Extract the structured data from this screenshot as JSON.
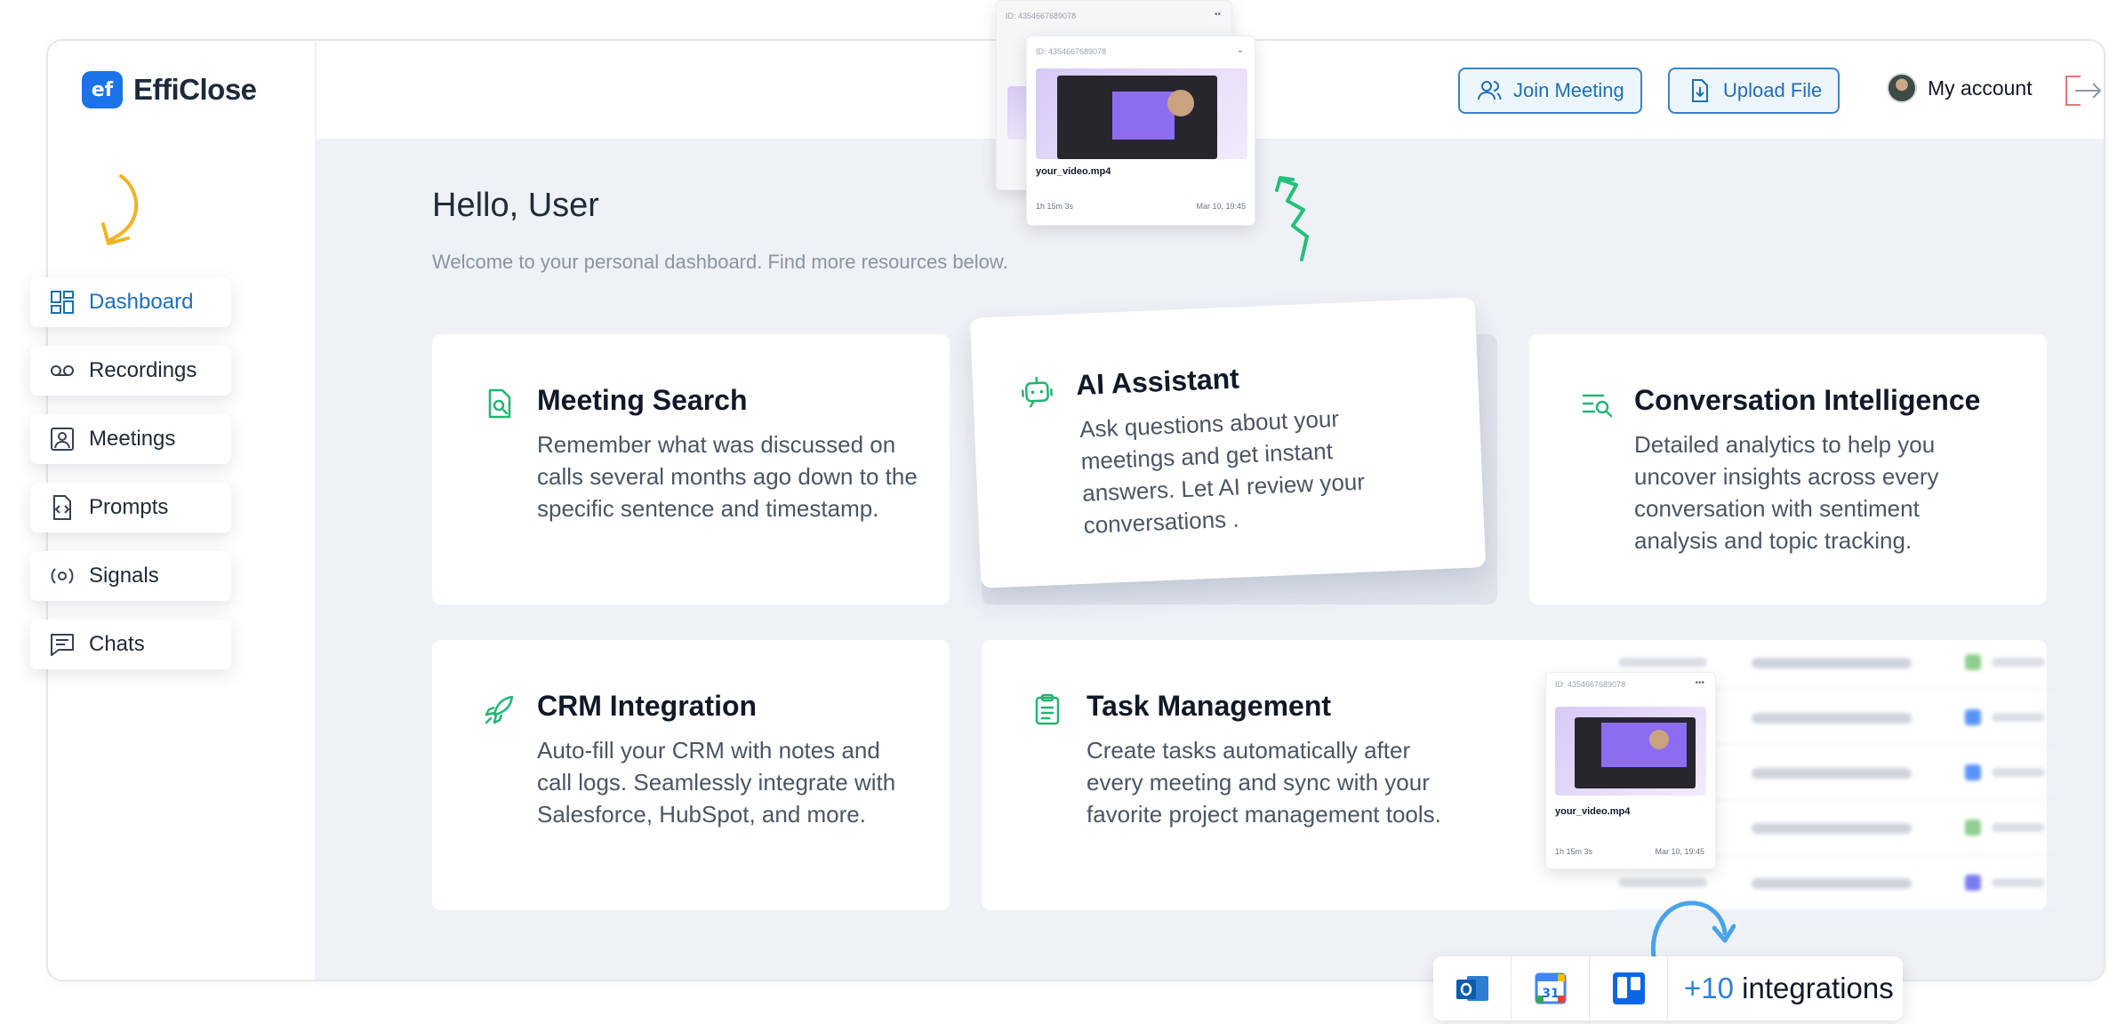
{
  "app": {
    "brand_badge": "ef",
    "brand_name": "EffiClose"
  },
  "topbar": {
    "join_meeting": "Join Meeting",
    "upload_file": "Upload File",
    "account": "My account"
  },
  "sidebar": {
    "items": [
      {
        "label": "Dashboard",
        "icon": "dashboard-icon",
        "active": true
      },
      {
        "label": "Recordings",
        "icon": "voicemail-icon",
        "active": false
      },
      {
        "label": "Meetings",
        "icon": "person-frame-icon",
        "active": false
      },
      {
        "label": "Prompts",
        "icon": "code-file-icon",
        "active": false
      },
      {
        "label": "Signals",
        "icon": "signal-icon",
        "active": false
      },
      {
        "label": "Chats",
        "icon": "chat-icon",
        "active": false
      }
    ]
  },
  "main": {
    "greeting": "Hello, User",
    "subtitle": "Welcome to your personal dashboard. Find more resources below.",
    "cards": [
      {
        "title": "Meeting Search",
        "body": "Remember what was discussed on calls several months ago down to the specific sentence and timestamp.",
        "icon": "file-search-icon"
      },
      {
        "title": "AI Assistant",
        "body": "Ask questions about your meetings and get instant answers. Let AI review your conversations .",
        "icon": "robot-icon"
      },
      {
        "title": "Conversation Intelligence",
        "body": "Detailed analytics to help you uncover insights across every conversation with sentiment analysis and topic tracking.",
        "icon": "list-search-icon"
      },
      {
        "title": "CRM Integration",
        "body": "Auto-fill your CRM with notes and call logs. Seamlessly integrate with Salesforce, HubSpot, and more.",
        "icon": "rocket-icon"
      },
      {
        "title": "Task Management",
        "body": "Create tasks automatically after every meeting and sync with your favorite project management tools.",
        "icon": "clipboard-icon"
      }
    ]
  },
  "previews": {
    "top_back": {
      "id": "ID: 4354667689078"
    },
    "top_front": {
      "id": "ID: 4354667689078",
      "file": "your_video.mp4",
      "duration": "1h 15m 3s",
      "date": "Mar 10, 19:45"
    },
    "bottom": {
      "id": "ID: 4354667689078",
      "file": "your_video.mp4",
      "duration": "1h 15m 3s",
      "date": "Mar 10, 19:45"
    }
  },
  "integrations": {
    "count": "+10",
    "label": "integrations",
    "icons": [
      "outlook-icon",
      "google-calendar-icon",
      "trello-icon"
    ]
  },
  "colors": {
    "accent": "#1d6fb8",
    "green": "#22b573",
    "brand": "#1a73e8",
    "arrow_yellow": "#f0b323",
    "arrow_blue": "#4aa3e6"
  }
}
